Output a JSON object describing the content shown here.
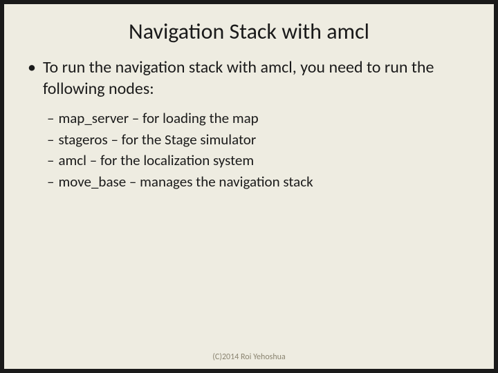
{
  "title": "Navigation Stack with amcl",
  "main_bullet": "To run the navigation stack with amcl, you need to run the following nodes:",
  "sub_bullets": [
    "map_server – for loading the map",
    "stageros – for the Stage simulator",
    "amcl – for the localization system",
    "move_base – manages the navigation stack"
  ],
  "footer": "(C)2014 Roi Yehoshua"
}
